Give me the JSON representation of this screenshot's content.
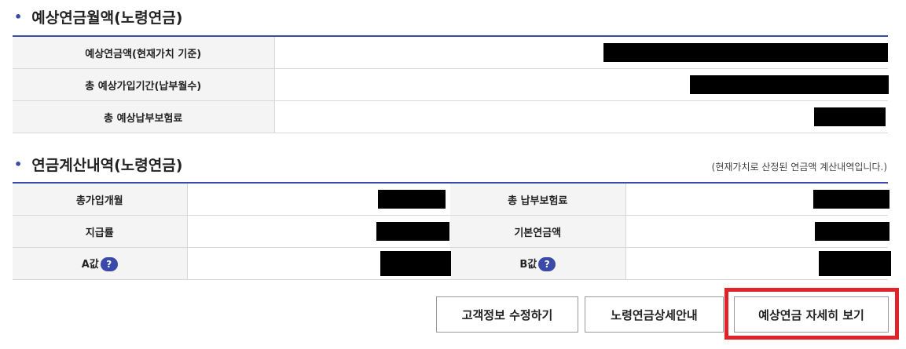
{
  "section1": {
    "title": "예상연금월액(노령연금)"
  },
  "section1_rows": [
    {
      "label": "예상연금액(현재가치 기준)"
    },
    {
      "label": "총 예상가입기간(납부월수)"
    },
    {
      "label": "총 예상납부보험료"
    }
  ],
  "section2": {
    "title": "연금계산내역(노령연금)",
    "note": "(현재가치로 산정된 연금액 계산내역입니다.)"
  },
  "section2_rows": [
    {
      "left_label": "총가입개월",
      "right_label": "총 납부보험료"
    },
    {
      "left_label": "지급률",
      "right_label": "기본연금액"
    },
    {
      "left_label": "A값",
      "right_label": "B값"
    }
  ],
  "help_icon": "?",
  "buttons": {
    "edit_customer": "고객정보 수정하기",
    "pension_detail_guide": "노령연금상세안내",
    "view_detail": "예상연금 자세히 보기"
  },
  "colors": {
    "accent": "#3a4aa8",
    "highlight": "#e0222a"
  },
  "icons": [
    "bullet-dot-icon",
    "help-question-icon"
  ]
}
